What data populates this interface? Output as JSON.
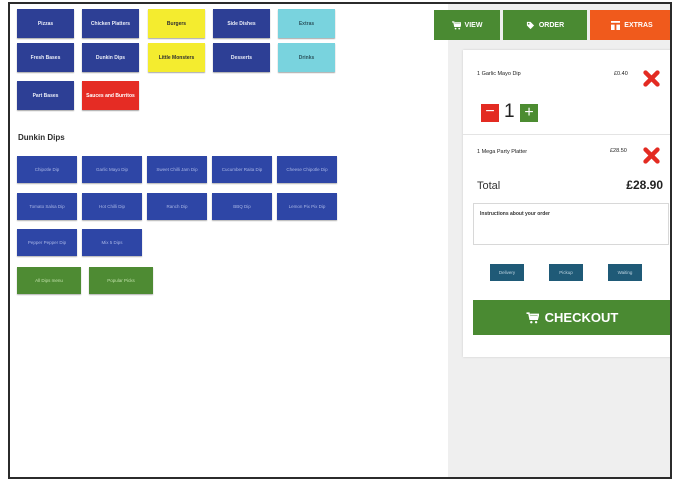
{
  "categories": [
    {
      "label": "Pizzas",
      "color": "blue"
    },
    {
      "label": "Chicken Platters",
      "color": "blue"
    },
    {
      "label": "Burgers",
      "color": "yellow"
    },
    {
      "label": "Side Dishes",
      "color": "blue"
    },
    {
      "label": "Extras",
      "color": "cyan"
    },
    {
      "label": "Fresh Bases",
      "color": "blue"
    },
    {
      "label": "Dunkin Dips",
      "color": "blue"
    },
    {
      "label": "Little Monsters",
      "color": "yellow"
    },
    {
      "label": "Desserts",
      "color": "blue"
    },
    {
      "label": "Drinks",
      "color": "cyan"
    },
    {
      "label": "Part Bases",
      "color": "blue"
    },
    {
      "label": "Sauces and Burritos",
      "color": "red"
    }
  ],
  "section_title": "Dunkin Dips",
  "items": [
    {
      "label": "Chipotle Dip",
      "color": "blue"
    },
    {
      "label": "Garlic Mayo Dip",
      "color": "blue"
    },
    {
      "label": "Sweet Chilli Jam Dip",
      "color": "blue"
    },
    {
      "label": "Cucumber Raita Dip",
      "color": "blue"
    },
    {
      "label": "Cheese Chipotle Dip",
      "color": "blue"
    },
    {
      "label": "Tomato Salsa Dip",
      "color": "blue"
    },
    {
      "label": "Hot Chilli Dip",
      "color": "blue"
    },
    {
      "label": "Ranch Dip",
      "color": "blue"
    },
    {
      "label": "BBQ Dip",
      "color": "blue"
    },
    {
      "label": "Lemon Pix Pix Dip",
      "color": "blue"
    },
    {
      "label": "Pepper Pepper Dip",
      "color": "blue"
    },
    {
      "label": "Mix 5 Dips",
      "color": "blue"
    },
    {
      "label": "All Dips menu",
      "color": "green"
    },
    {
      "label": "Popular Picks",
      "color": "green"
    }
  ],
  "topbar": {
    "view": "VIEW",
    "order": "ORDER",
    "extras": "EXTRAS",
    "view_icon": "cart-icon",
    "order_icon": "tag-icon",
    "extras_icon": "grid-icon"
  },
  "order": {
    "lines": [
      {
        "name": "1 Garlic Mayo Dip",
        "price": "£0.40"
      },
      {
        "name": "1 Mega Party Platter",
        "price": "£28.50"
      }
    ],
    "quantity": "1",
    "total_label": "Total",
    "total_value": "£28.90",
    "notes_placeholder": "Instructions about your order",
    "actions": [
      "Delivery",
      "Pickup",
      "Waiting"
    ],
    "checkout_label": "CHECKOUT"
  },
  "colors": {
    "blue": "#2d3f95",
    "yellow": "#f4ec2f",
    "cyan": "#79d3de",
    "red": "#e52c24",
    "green": "#4a8a32",
    "orange": "#f05a1c"
  }
}
